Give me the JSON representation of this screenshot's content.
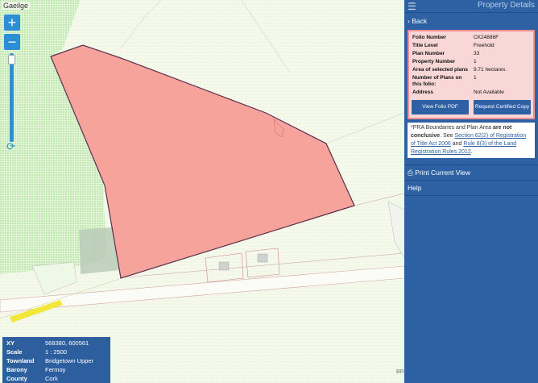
{
  "map": {
    "language_toggle": "Gaeilge",
    "zoom_in": "+",
    "zoom_out": "−",
    "attribution": "BR",
    "info": [
      {
        "key": "XY",
        "value": "568380, 600561"
      },
      {
        "key": "Scale",
        "value": "1 : 2500"
      },
      {
        "key": "Townland",
        "value": "Bridgetown Upper"
      },
      {
        "key": "Barony",
        "value": "Fermoy"
      },
      {
        "key": "County",
        "value": "Cork"
      }
    ]
  },
  "panel": {
    "title": "Property Details",
    "back": "Back",
    "details": [
      {
        "key": "Folio Number",
        "value": "CK24886F"
      },
      {
        "key": "Title Level",
        "value": "Freehold"
      },
      {
        "key": "Plan Number",
        "value": "33"
      },
      {
        "key": "Property Number",
        "value": "1"
      },
      {
        "key": "Area of selected plans",
        "value": "9.71 hectares."
      },
      {
        "key": "Number of Plans on this folio:",
        "value": "1"
      },
      {
        "key": "Address",
        "value": "Not Available"
      }
    ],
    "view_folio": "View Folio PDF",
    "request_copy": "Request Certified Copy",
    "note_a": "*PRA Boundaries and Plan Area ",
    "note_b": "are not conclusive",
    "note_c": ". See ",
    "note_link1": "Section 62(2) of Registration of Title Act 2006",
    "note_d": " and ",
    "note_link2": "Rule 8(3) of the Land Registration Rules 2012",
    "note_e": ".",
    "print": "Print Current View",
    "help": "Help"
  },
  "colors": {
    "panel": "#2d61a3",
    "parcel": "#f6a39b",
    "card": "#f9d7d7"
  }
}
